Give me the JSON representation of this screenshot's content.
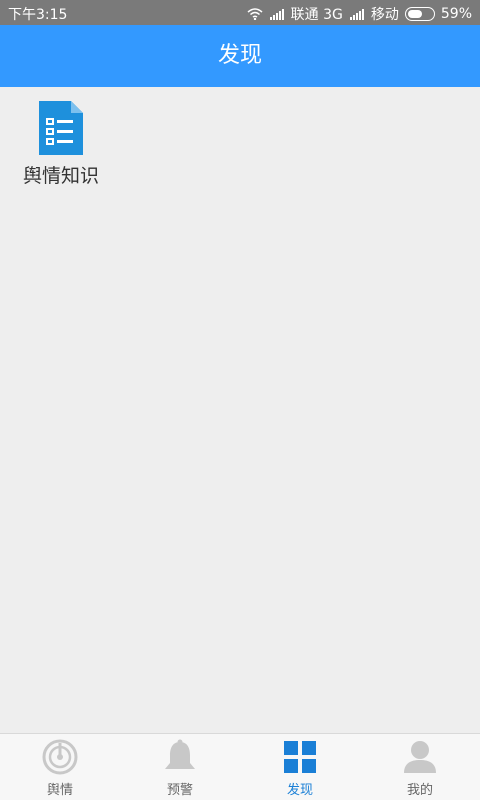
{
  "status_bar": {
    "time": "下午3:15",
    "carrier1": "联通 3G",
    "carrier2": "移动",
    "battery_percent": "59%",
    "battery_level": 0.59
  },
  "header": {
    "title": "发现"
  },
  "content": {
    "items": [
      {
        "label": "舆情知识",
        "icon": "document-list-icon"
      }
    ]
  },
  "bottom_nav": {
    "items": [
      {
        "label": "舆情",
        "icon": "radar-icon",
        "active": false
      },
      {
        "label": "预警",
        "icon": "bell-icon",
        "active": false
      },
      {
        "label": "发现",
        "icon": "grid-icon",
        "active": true
      },
      {
        "label": "我的",
        "icon": "user-icon",
        "active": false
      }
    ]
  },
  "colors": {
    "header_bg": "#3399ff",
    "active_tab": "#1a7fd6",
    "inactive_icon": "#c8c8c8",
    "status_bar_bg": "#7a7a7a"
  }
}
